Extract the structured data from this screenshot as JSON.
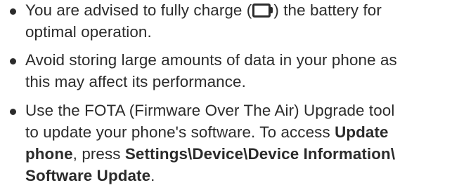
{
  "items": [
    {
      "line1_before": "You are advised to fully charge (",
      "battery_icon": "battery-full-icon",
      "line1_after": ") the battery for",
      "line2": "optimal operation."
    },
    {
      "line1": "Avoid storing large amounts of data in your phone as",
      "line2": "this may affect its performance."
    },
    {
      "line1": "Use the FOTA (Firmware Over The Air) Upgrade tool",
      "line2_text": "to update your phone's software. To access ",
      "line2_bold": "Update",
      "line3_bold1": "phone",
      "line3_text": ", press ",
      "line3_bold2": "Settings\\Device\\Device Information\\",
      "line4_bold": "Software Update",
      "line4_text": "."
    }
  ]
}
